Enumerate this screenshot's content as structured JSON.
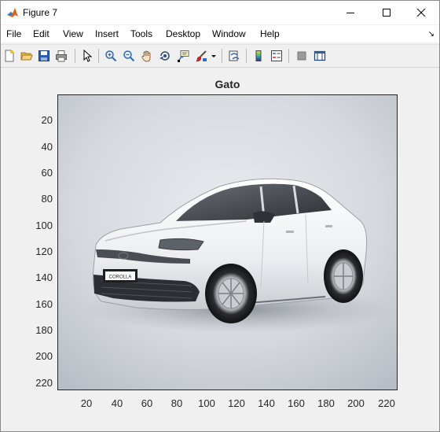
{
  "window": {
    "title": "Figure 7",
    "icon": "matlab-icon",
    "controls": [
      "minimize-icon",
      "maximize-icon",
      "close-icon"
    ]
  },
  "menu": {
    "items": [
      "File",
      "Edit",
      "View",
      "Insert",
      "Tools",
      "Desktop",
      "Window",
      "Help"
    ],
    "dock_glyph": "↘"
  },
  "toolbar": {
    "icons": [
      "new-figure-icon",
      "open-file-icon",
      "save-icon",
      "print-icon",
      "edit-plot-arrow-icon",
      "zoom-in-icon",
      "zoom-out-icon",
      "pan-hand-icon",
      "rotate-3d-icon",
      "data-cursor-icon",
      "brush-icon",
      "brush-dropdown-icon",
      "link-plot-icon",
      "colorbar-icon",
      "legend-icon",
      "hide-plot-tools-icon",
      "show-plot-tools-icon"
    ]
  },
  "axes": {
    "title": "Gato",
    "yticks": [
      "20",
      "40",
      "60",
      "80",
      "100",
      "120",
      "140",
      "160",
      "180",
      "200",
      "220"
    ],
    "xticks": [
      "20",
      "40",
      "60",
      "80",
      "100",
      "120",
      "140",
      "160",
      "180",
      "200",
      "220"
    ],
    "image_subject": "white-sedan-photo",
    "plate_text": "COROLLA"
  }
}
